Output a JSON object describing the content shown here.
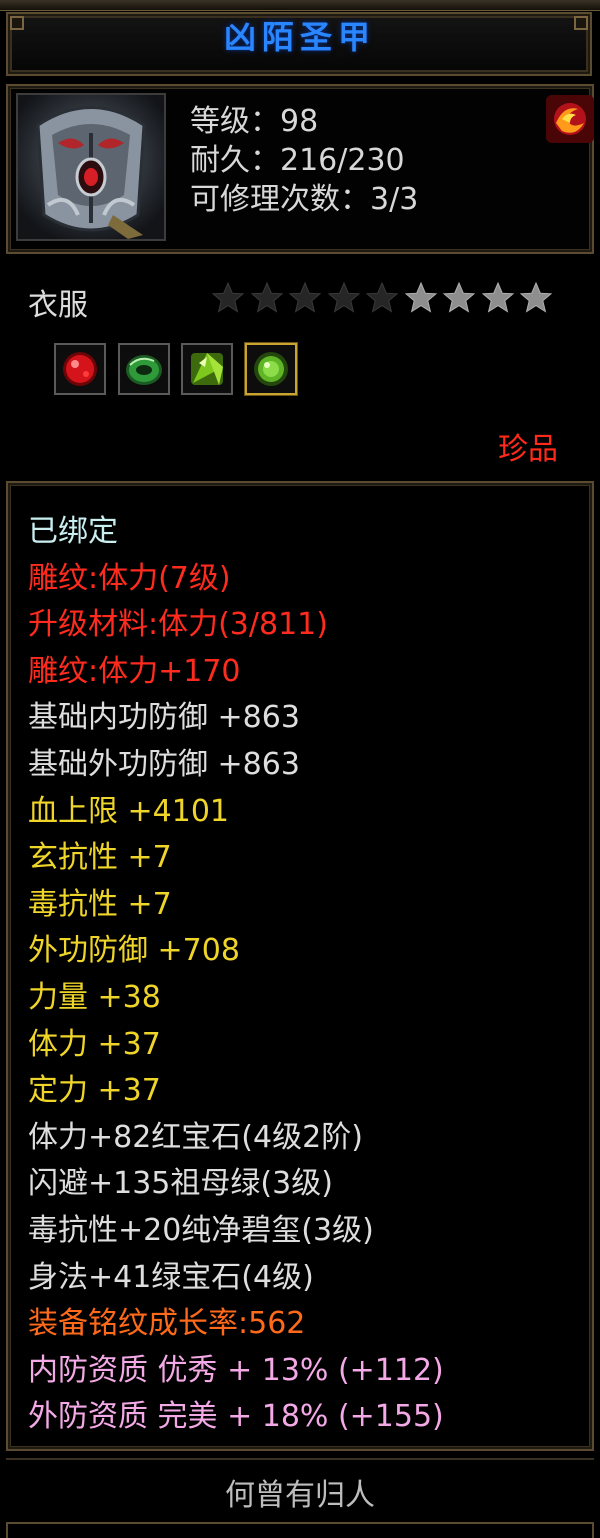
{
  "item": {
    "name": "凶陌圣甲",
    "level_line": "等级：98",
    "durability_line": "耐久：216/230",
    "repair_line": "可修理次数：3/3",
    "category": "衣服",
    "rarity": "珍品",
    "stars": {
      "total": 9,
      "filled": 5
    }
  },
  "gems": [
    {
      "name": "red-gem-icon",
      "color": "#d4141a"
    },
    {
      "name": "jade-ring-icon",
      "color": "#2f9a3a"
    },
    {
      "name": "green-crystal-icon",
      "color": "#7ec81e"
    },
    {
      "name": "green-gem-icon",
      "color": "#5fb526"
    }
  ],
  "attributes": [
    {
      "text": "已绑定",
      "style": "bound"
    },
    {
      "text": "雕纹:体力(7级)",
      "style": "red"
    },
    {
      "text": "升级材料:体力(3/811)",
      "style": "red"
    },
    {
      "text": "雕纹:体力+170",
      "style": "red"
    },
    {
      "text": "基础内功防御 +863",
      "style": "white"
    },
    {
      "text": "基础外功防御 +863",
      "style": "white"
    },
    {
      "text": "血上限 +4101",
      "style": "yellow"
    },
    {
      "text": "玄抗性 +7",
      "style": "yellow"
    },
    {
      "text": "毒抗性 +7",
      "style": "yellow"
    },
    {
      "text": "外功防御 +708",
      "style": "yellow"
    },
    {
      "text": "力量 +38",
      "style": "yellow"
    },
    {
      "text": "体力 +37",
      "style": "yellow"
    },
    {
      "text": "定力 +37",
      "style": "yellow"
    },
    {
      "text": "体力+82红宝石(4级2阶)",
      "style": "white"
    },
    {
      "text": "闪避+135祖母绿(3级)",
      "style": "white"
    },
    {
      "text": "毒抗性+20纯净碧玺(3级)",
      "style": "white"
    },
    {
      "text": "身法+41绿宝石(4级)",
      "style": "white"
    },
    {
      "text": "装备铭纹成长率:562",
      "style": "orange"
    },
    {
      "text": "内防资质 优秀 + 13% (+112)",
      "style": "pink"
    },
    {
      "text": "外防资质 完美 + 18% (+155)",
      "style": "pink"
    }
  ],
  "footer": {
    "text": "何曾有归人"
  },
  "colors": {
    "title": "#2a86ff",
    "red": "#ff2b1e",
    "yellow": "#efd52a",
    "orange": "#ff6a1a",
    "pink": "#f3a9e6",
    "bound": "#c8eef0",
    "frame": "#5a4b31"
  }
}
